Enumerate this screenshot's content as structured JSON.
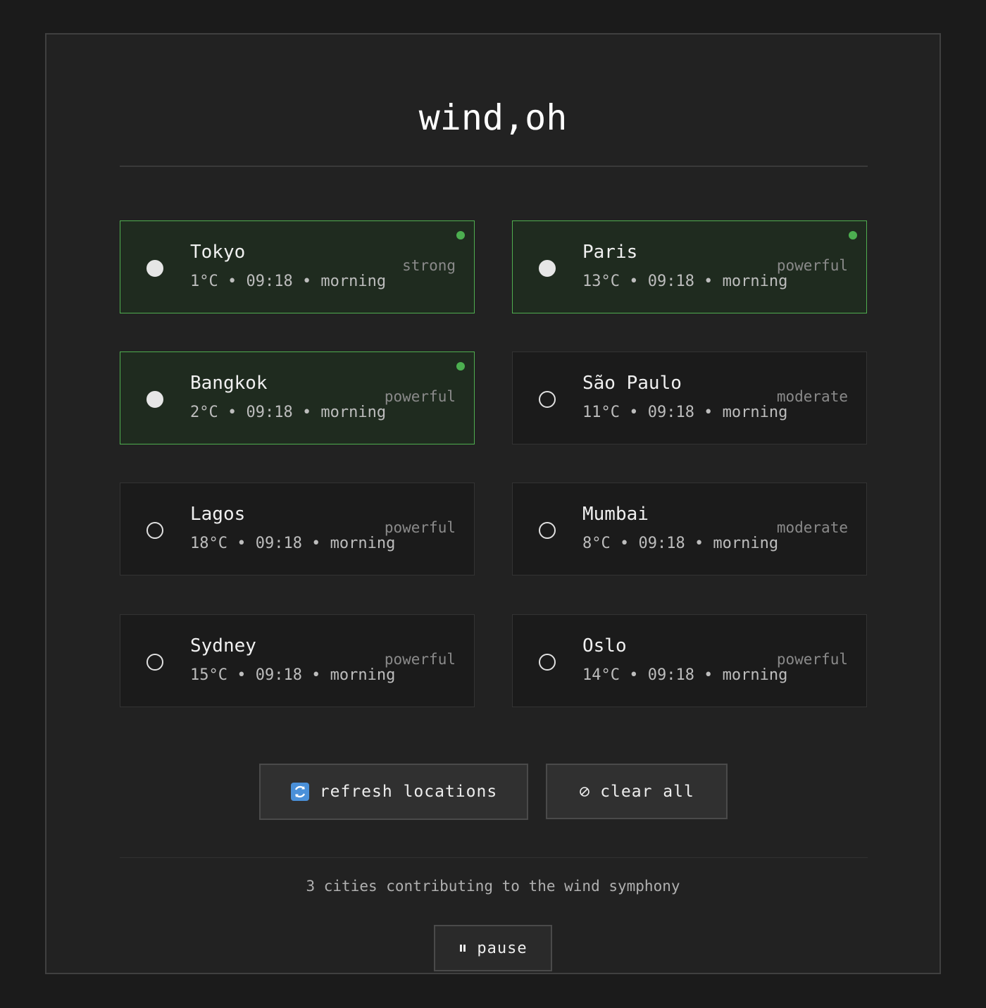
{
  "app": {
    "title": "wind,oh"
  },
  "cities": [
    {
      "name": "Tokyo",
      "meta": "1°C • 09:18 • morning",
      "strength": "strong",
      "active": true
    },
    {
      "name": "Paris",
      "meta": "13°C • 09:18 • morning",
      "strength": "powerful",
      "active": true
    },
    {
      "name": "Bangkok",
      "meta": "2°C • 09:18 • morning",
      "strength": "powerful",
      "active": true
    },
    {
      "name": "São Paulo",
      "meta": "11°C • 09:18 • morning",
      "strength": "moderate",
      "active": false
    },
    {
      "name": "Lagos",
      "meta": "18°C • 09:18 • morning",
      "strength": "powerful",
      "active": false
    },
    {
      "name": "Mumbai",
      "meta": "8°C • 09:18 • morning",
      "strength": "moderate",
      "active": false
    },
    {
      "name": "Sydney",
      "meta": "15°C • 09:18 • morning",
      "strength": "powerful",
      "active": false
    },
    {
      "name": "Oslo",
      "meta": "14°C • 09:18 • morning",
      "strength": "powerful",
      "active": false
    }
  ],
  "controls": {
    "refresh_icon": "refresh-icon",
    "refresh_label": "refresh locations",
    "clear_icon": "no-entry-icon",
    "clear_label": "clear all",
    "pause_icon": "pause-icon",
    "pause_label": "pause"
  },
  "status": {
    "text": "3 cities contributing to the wind symphony"
  },
  "colors": {
    "background": "#1b1b1b",
    "panel": "#222222",
    "active_card": "#1f2b1f",
    "active_border": "#4fae4f",
    "live_dot": "#4caf50"
  }
}
